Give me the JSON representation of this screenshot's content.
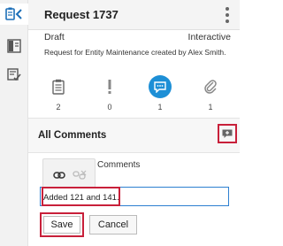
{
  "header": {
    "title": "Request 1737"
  },
  "request": {
    "status": "Draft",
    "mode": "Interactive",
    "description": "Request for Entity Maintenance created by Alex Smith."
  },
  "tabs": [
    {
      "icon": "clipboard-icon",
      "count": "2"
    },
    {
      "icon": "exclamation-icon",
      "count": "0"
    },
    {
      "icon": "comment-icon",
      "count": "1"
    },
    {
      "icon": "paperclip-icon",
      "count": "1"
    }
  ],
  "comments": {
    "title": "All Comments",
    "sublabel": "Comments",
    "input_value": "Added 121 and 141.",
    "save_label": "Save",
    "cancel_label": "Cancel"
  },
  "colors": {
    "accent": "#1d8fd6",
    "highlight": "#c8203a",
    "input_border": "#2d7fd0"
  },
  "rail": [
    "clipboard-collapse-icon",
    "split-panel-icon",
    "checklist-icon"
  ]
}
